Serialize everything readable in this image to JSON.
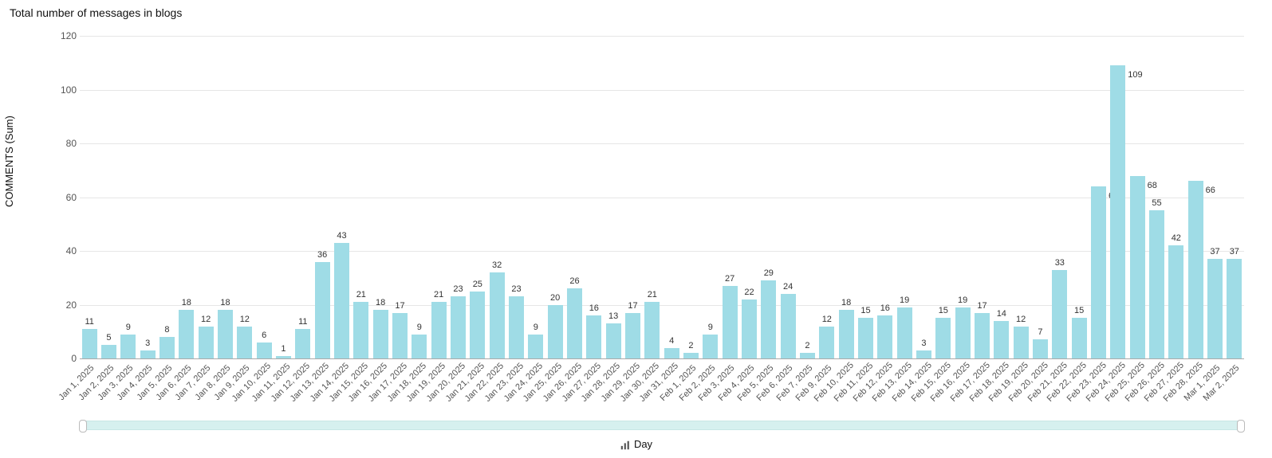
{
  "title": "Total number of messages in blogs",
  "yaxis_label": "COMMENTS (Sum)",
  "xaxis_label": "Day",
  "chart_data": {
    "type": "bar",
    "ylabel": "COMMENTS (Sum)",
    "xlabel": "Day",
    "title": "Total number of messages in blogs",
    "ylim": [
      0,
      120
    ],
    "yticks": [
      0,
      20,
      40,
      60,
      80,
      100,
      120
    ],
    "categories": [
      "Jan 1, 2025",
      "Jan 2, 2025",
      "Jan 3, 2025",
      "Jan 4, 2025",
      "Jan 5, 2025",
      "Jan 6, 2025",
      "Jan 7, 2025",
      "Jan 8, 2025",
      "Jan 9, 2025",
      "Jan 10, 2025",
      "Jan 11, 2025",
      "Jan 12, 2025",
      "Jan 13, 2025",
      "Jan 14, 2025",
      "Jan 15, 2025",
      "Jan 16, 2025",
      "Jan 17, 2025",
      "Jan 18, 2025",
      "Jan 19, 2025",
      "Jan 20, 2025",
      "Jan 21, 2025",
      "Jan 22, 2025",
      "Jan 23, 2025",
      "Jan 24, 2025",
      "Jan 25, 2025",
      "Jan 26, 2025",
      "Jan 27, 2025",
      "Jan 28, 2025",
      "Jan 29, 2025",
      "Jan 30, 2025",
      "Jan 31, 2025",
      "Feb 1, 2025",
      "Feb 2, 2025",
      "Feb 3, 2025",
      "Feb 4, 2025",
      "Feb 5, 2025",
      "Feb 6, 2025",
      "Feb 7, 2025",
      "Feb 9, 2025",
      "Feb 10, 2025",
      "Feb 11, 2025",
      "Feb 12, 2025",
      "Feb 13, 2025",
      "Feb 14, 2025",
      "Feb 15, 2025",
      "Feb 16, 2025",
      "Feb 17, 2025",
      "Feb 18, 2025",
      "Feb 19, 2025",
      "Feb 20, 2025",
      "Feb 21, 2025",
      "Feb 22, 2025",
      "Feb 23, 2025",
      "Feb 24, 2025",
      "Feb 25, 2025",
      "Feb 26, 2025",
      "Feb 27, 2025",
      "Feb 28, 2025",
      "Mar 1, 2025",
      "Mar 2, 2025"
    ],
    "values": [
      11,
      5,
      9,
      3,
      8,
      18,
      12,
      18,
      12,
      6,
      1,
      11,
      36,
      43,
      21,
      18,
      17,
      9,
      21,
      23,
      25,
      32,
      23,
      9,
      20,
      26,
      16,
      13,
      17,
      21,
      4,
      2,
      9,
      27,
      22,
      29,
      24,
      2,
      12,
      18,
      15,
      16,
      19,
      3,
      15,
      19,
      17,
      14,
      12,
      7,
      33,
      15,
      64,
      109,
      68,
      55,
      42,
      66,
      37,
      37
    ]
  },
  "accent_color": "#9fdce6"
}
